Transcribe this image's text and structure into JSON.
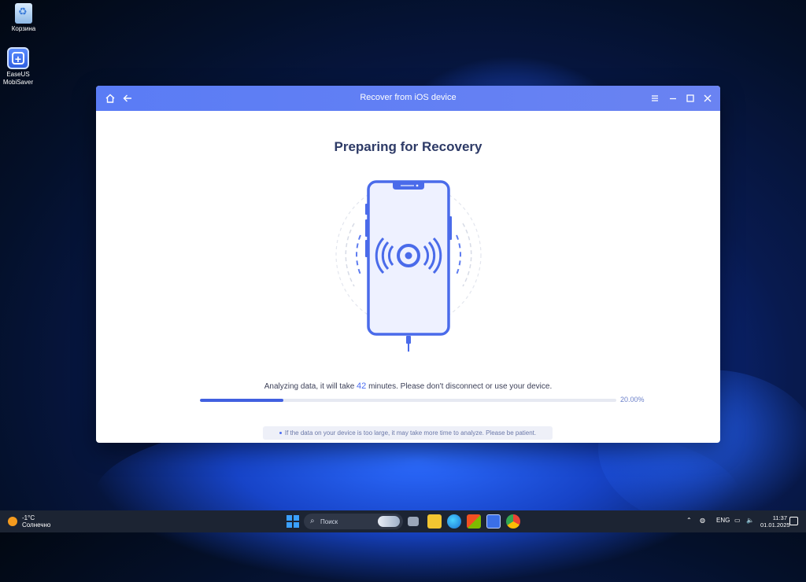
{
  "desktop": {
    "icons": [
      {
        "label": "Корзина"
      },
      {
        "label": "EaseUS MobiSaver"
      }
    ]
  },
  "window": {
    "title": "Recover from iOS device",
    "heading": "Preparing for Recovery",
    "status": {
      "prefix": "Analyzing data, it will take",
      "minutes": "42",
      "suffix": "minutes. Please don't disconnect or use your device."
    },
    "progress": {
      "value": 0.2,
      "percent_text": "20.00%"
    },
    "hint": "If the data on your device is too large, it may take more time to analyze. Please be patient."
  },
  "taskbar": {
    "weather_temp": "-1°C",
    "weather_desc": "Солнечно",
    "search_placeholder": "Поиск",
    "language": "ENG",
    "time": "11:37",
    "date": "01.01.2025"
  },
  "colors": {
    "titlebar": "#5a7cf5",
    "accent": "#4d6ef2",
    "heading": "#2d3a66"
  }
}
